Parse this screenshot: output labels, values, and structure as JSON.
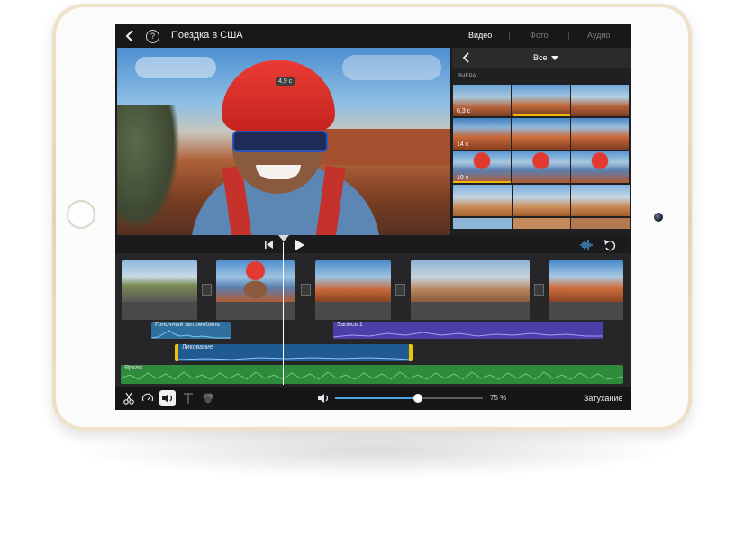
{
  "topbar": {
    "project_title": "Поездка в США",
    "tabs": [
      {
        "label": "Видео",
        "active": true
      },
      {
        "label": "Фото",
        "active": false
      },
      {
        "label": "Аудио",
        "active": false
      }
    ],
    "help_glyph": "?"
  },
  "viewer": {
    "clip_duration": "4,9 c"
  },
  "browser": {
    "filter_label": "Все",
    "section_label": "ВЧЕРА",
    "thumb_durations": [
      "6,3 c",
      "14 c",
      "10 c"
    ]
  },
  "timeline": {
    "audio_tracks": [
      {
        "label": "Гоночный автомобиль",
        "color": "#2f6f9e"
      },
      {
        "label": "Запись 1",
        "color": "#4a3fa6"
      },
      {
        "label": "Ликование",
        "color": "#1f5a92"
      },
      {
        "label": "Яркая",
        "color": "#2f8a3c"
      }
    ],
    "selection_color": "#f0c400"
  },
  "toolbar": {
    "volume_percent_label": "75 %",
    "volume_level": 0.56,
    "fade_label": "Затухание",
    "accent": "#4ea6e8"
  },
  "icons": [
    "back-chevron-icon",
    "help-icon",
    "scissors-icon",
    "speed-icon",
    "volume-icon",
    "titles-icon",
    "filters-icon",
    "skip-back-icon",
    "play-icon",
    "waveform-icon",
    "undo-icon",
    "dropdown-caret-icon"
  ]
}
